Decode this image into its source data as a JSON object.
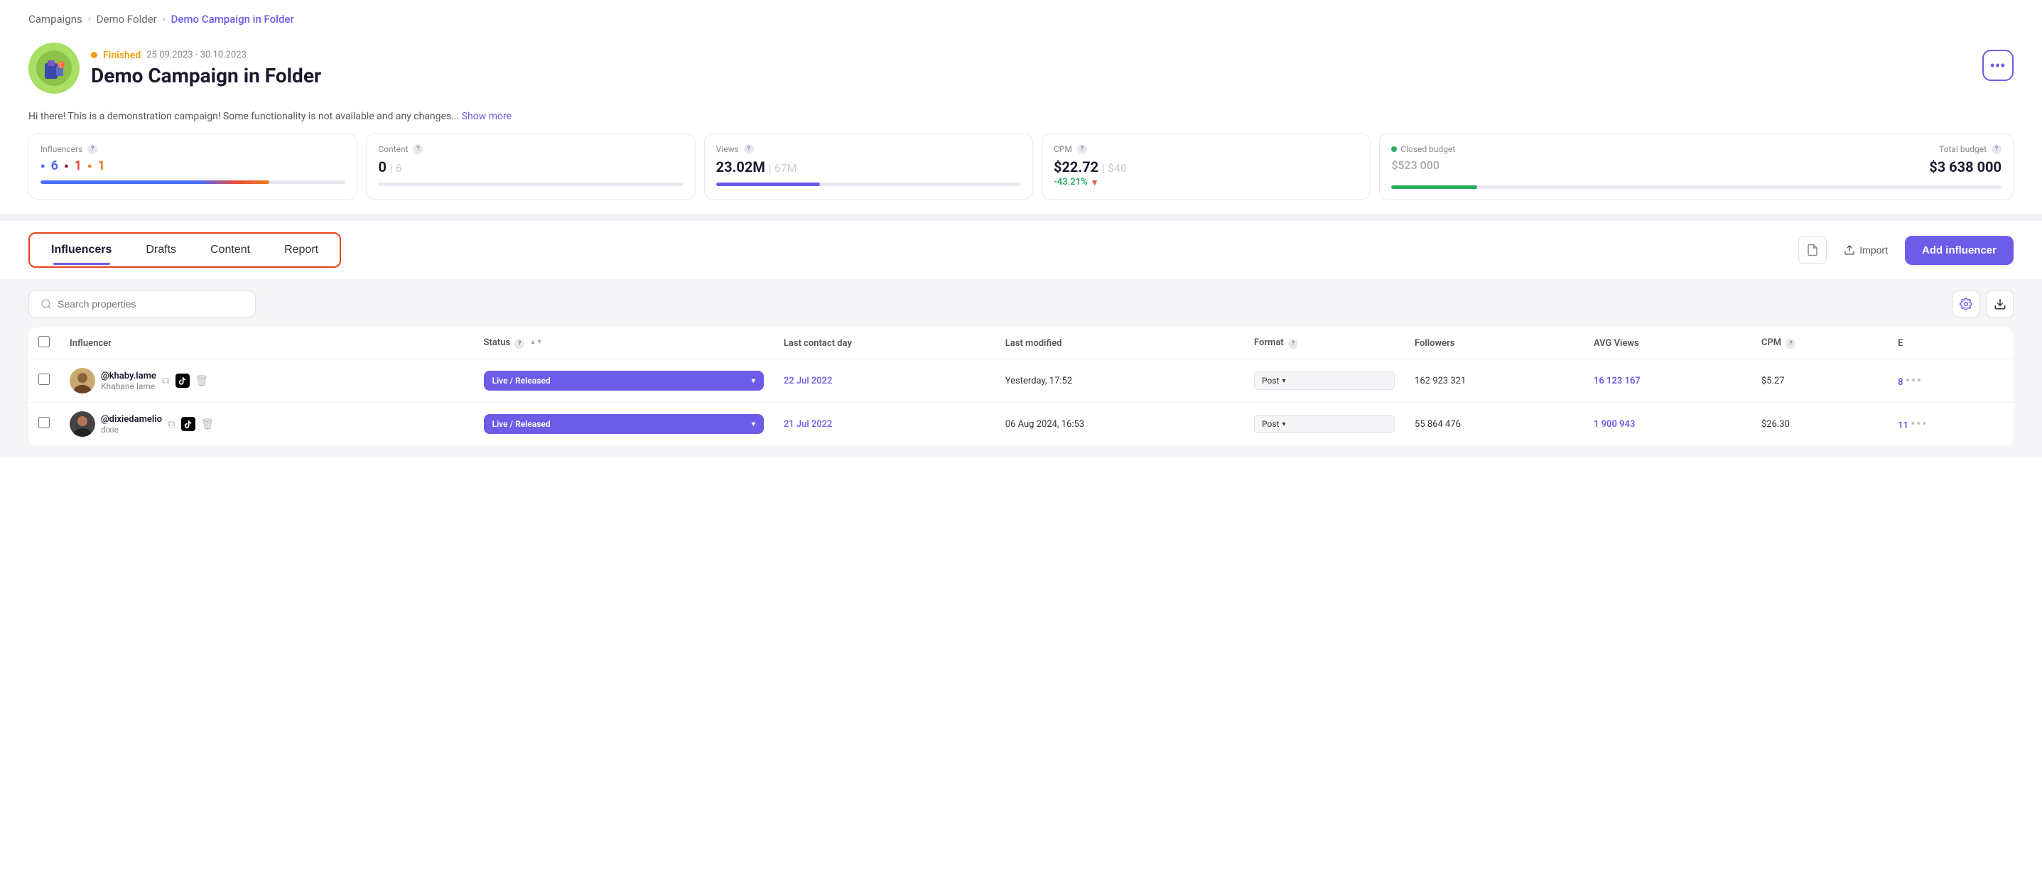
{
  "breadcrumb": {
    "items": [
      "Campaigns",
      "Demo Folder",
      "Demo Campaign in Folder"
    ],
    "separators": [
      "›",
      "›"
    ]
  },
  "campaign": {
    "status_dot_color": "#f39c12",
    "status_label": "Finished",
    "date_range": "25.09.2023 - 30.10.2023",
    "title": "Demo Campaign in Folder",
    "description": "Hi there! This is a demonstration campaign! Some functionality is not available and any changes...",
    "show_more": "Show more",
    "menu_btn_label": "•••"
  },
  "stats": {
    "influencers": {
      "label": "Influencers",
      "blue": "6",
      "red_dark": "1",
      "orange": "1"
    },
    "content": {
      "label": "Content",
      "value": "0",
      "total": "6"
    },
    "views": {
      "label": "Views",
      "value": "23.02M",
      "total": "67M"
    },
    "cpm": {
      "label": "CPM",
      "value": "$22.72",
      "total": "$40",
      "change": "-43.21%"
    },
    "closed_budget": {
      "label": "Closed budget",
      "value": "$523 000"
    },
    "total_budget": {
      "label": "Total budget",
      "value": "$3 638 000"
    }
  },
  "tabs": {
    "items": [
      "Influencers",
      "Drafts",
      "Content",
      "Report"
    ],
    "active": "Influencers"
  },
  "actions": {
    "file_icon": "📄",
    "import_label": "Import",
    "add_influencer_label": "Add influencer"
  },
  "search": {
    "placeholder": "Search properties"
  },
  "table": {
    "columns": [
      "Influencer",
      "Status",
      "Last contact day",
      "Last modified",
      "Format",
      "Followers",
      "AVG Views",
      "CPM",
      "E"
    ],
    "rows": [
      {
        "handle": "@khaby.lame",
        "name": "Khabane lame",
        "status": "Live / Released",
        "last_contact": "22 Jul 2022",
        "last_modified": "Yesterday, 17:52",
        "format": "Post",
        "followers": "162 923 321",
        "avg_views": "16 123 167",
        "cpm": "$5.27",
        "e": "8"
      },
      {
        "handle": "@dixiedamelio",
        "name": "dixie",
        "status": "Live / Released",
        "last_contact": "21 Jul 2022",
        "last_modified": "06 Aug 2024, 16:53",
        "format": "Post",
        "followers": "55 864 476",
        "avg_views": "1 900 943",
        "cpm": "$26.30",
        "e": "11"
      }
    ]
  },
  "colors": {
    "purple": "#6c5ce7",
    "orange_status": "#f39c12",
    "red_border": "#e8431f",
    "blue": "#4a6cf7",
    "green": "#27ae60",
    "light_bg": "#f5f5f7"
  }
}
